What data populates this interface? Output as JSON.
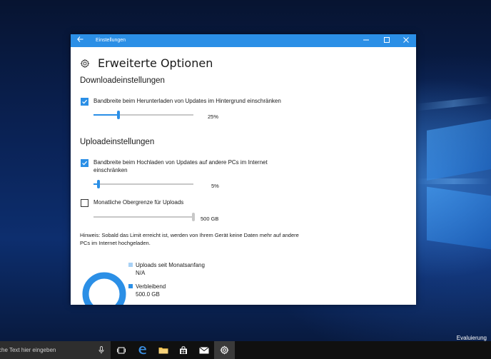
{
  "desktop": {
    "watermark_text": "Evaluierung"
  },
  "window": {
    "title": "Einstellungen",
    "controls": {
      "minimize": "—",
      "maximize": "☐",
      "close": "✕"
    }
  },
  "page": {
    "title": "Erweiterte Optionen",
    "icon": "gear-icon"
  },
  "download": {
    "section_title": "Downloadeinstellungen",
    "limit_checkbox": {
      "label": "Bandbreite beim Herunterladen von Updates im Hintergrund einschränken",
      "checked": true
    },
    "slider": {
      "value_percent": 25,
      "value_label": "25%"
    }
  },
  "upload": {
    "section_title": "Uploadeinstellungen",
    "limit_checkbox": {
      "label": "Bandbreite beim Hochladen von Updates auf andere PCs im Internet einschränken",
      "checked": true
    },
    "slider": {
      "value_percent": 5,
      "value_label": "5%"
    },
    "monthly_checkbox": {
      "label": "Monatliche Obergrenze für Uploads",
      "checked": false
    },
    "monthly_slider": {
      "value_fraction": 1.0,
      "value_label": "500 GB"
    },
    "hint": "Hinweis: Sobald das Limit erreicht ist, werden von Ihrem Gerät keine Daten mehr auf andere PCs im Internet hochgeladen."
  },
  "usage": {
    "items": [
      {
        "label": "Uploads seit Monatsanfang",
        "value": "N/A",
        "color": "#a8d1f5"
      },
      {
        "label": "Verbleibend",
        "value": "500.0 GB",
        "color": "#2b8fe6"
      }
    ],
    "donut_color": "#2b8fe6"
  },
  "taskbar": {
    "search_placeholder": "che Text hier eingeben",
    "icons": [
      "task-view-icon",
      "edge-icon",
      "explorer-icon",
      "store-icon",
      "mail-icon",
      "settings-icon"
    ]
  }
}
